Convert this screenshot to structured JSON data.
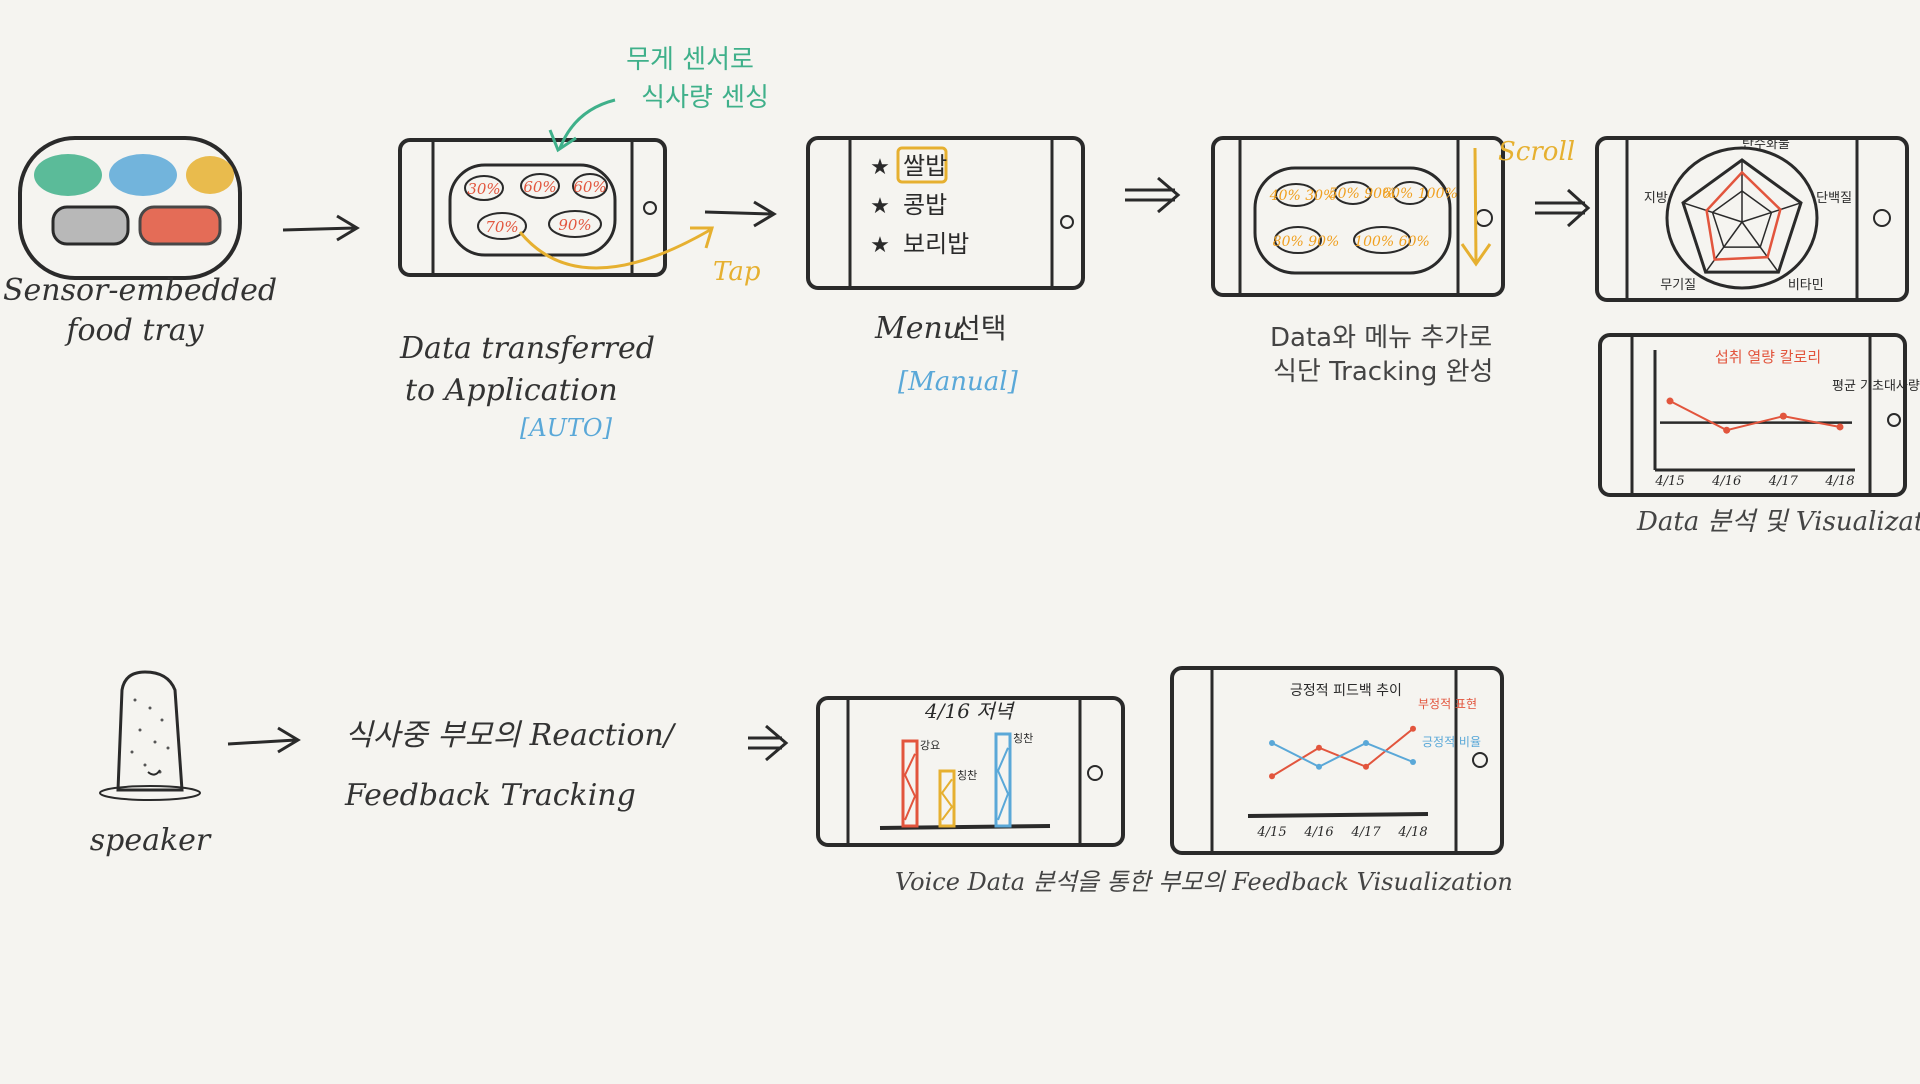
{
  "colors": {
    "ink": "#2a2a2a",
    "green": "#3fb08a",
    "blue": "#5aa8d8",
    "yellow": "#e6b030",
    "gray": "#b8b8b8",
    "red": "#e2553d",
    "orange": "#f0a020",
    "bg": "#f5f4f0"
  },
  "step1": {
    "label_line1": "Sensor-embedded",
    "label_line2": "food tray"
  },
  "step2": {
    "annotation_line1": "무게 센서로",
    "annotation_line2": "식사량 센싱",
    "tray_values": [
      "30%",
      "60%",
      "60%",
      "70%",
      "90%"
    ],
    "tap_label": "Tap",
    "label_line1": "Data transferred",
    "label_line2": "to Application",
    "mode_label": "[AUTO]"
  },
  "step3": {
    "menu_items": [
      "쌀밥",
      "콩밥",
      "보리밥"
    ],
    "label_prefix": "Menu",
    "label_ko": "선택",
    "mode_label": "[Manual]"
  },
  "step4": {
    "scroll_label": "Scroll",
    "tray_values": [
      "40% 30%",
      "50% 90%",
      "60% 100%",
      "80% 90%",
      "100% 60%"
    ],
    "label_line1": "Data와 메뉴 추가로",
    "label_line2": "식단 Tracking 완성"
  },
  "step5": {
    "radar_axes": [
      "탄수화물",
      "단백질",
      "비타민",
      "무기질",
      "지방"
    ],
    "line_chart_title": "섭취 열량 칼로리",
    "line_chart_ref_label": "평균 기초대사량",
    "dates": [
      "4/15",
      "4/16",
      "4/17",
      "4/18"
    ],
    "label": "Data 분석 및 Visualization"
  },
  "step6": {
    "label": "speaker"
  },
  "step7": {
    "label_line1": "식사중 부모의 Reaction/",
    "label_line2": "Feedback Tracking"
  },
  "step8": {
    "bar_chart_title": "4/16 저녁",
    "bar_labels": [
      "강요",
      "칭찬",
      "칭찬"
    ],
    "line_chart_title": "긍정적 피드백 추이",
    "line_series_labels": [
      "부정적 표현",
      "긍정적 비율"
    ],
    "dates": [
      "4/15",
      "4/16",
      "4/17",
      "4/18"
    ],
    "label": "Voice Data 분석을 통한 부모의 Feedback Visualization"
  },
  "chart_data": [
    {
      "type": "radar",
      "categories": [
        "탄수화물",
        "단백질",
        "비타민",
        "무기질",
        "지방"
      ],
      "values": [
        0.8,
        0.65,
        0.7,
        0.75,
        0.6
      ]
    },
    {
      "type": "line",
      "title": "섭취 열량 칼로리",
      "categories": [
        "4/15",
        "4/16",
        "4/17",
        "4/18"
      ],
      "series": [
        {
          "name": "섭취 열량 칼로리",
          "values": [
            0.62,
            0.35,
            0.48,
            0.38
          ]
        }
      ],
      "reference_line": {
        "name": "평균 기초대사량",
        "value": 0.42
      }
    },
    {
      "type": "bar",
      "title": "4/16 저녁",
      "categories": [
        "강요",
        "칭찬",
        "칭찬"
      ],
      "values": [
        0.85,
        0.55,
        0.92
      ],
      "colors": [
        "#e2553d",
        "#e6b030",
        "#5aa8d8"
      ]
    },
    {
      "type": "line",
      "title": "긍정적 피드백 추이",
      "categories": [
        "4/15",
        "4/16",
        "4/17",
        "4/18"
      ],
      "series": [
        {
          "name": "부정적 표현",
          "values": [
            0.25,
            0.55,
            0.35,
            0.75
          ]
        },
        {
          "name": "긍정적 비율",
          "values": [
            0.6,
            0.35,
            0.6,
            0.4
          ]
        }
      ]
    }
  ]
}
